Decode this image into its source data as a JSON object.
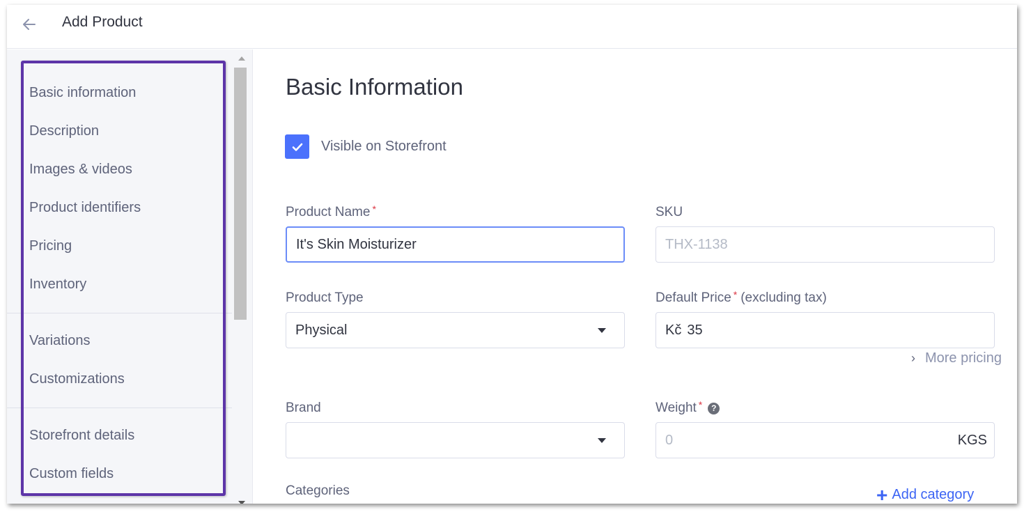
{
  "header": {
    "back_icon": "arrow-left-icon",
    "title": "Add Product"
  },
  "sidebar": {
    "groups": [
      {
        "items": [
          {
            "label": "Basic information"
          },
          {
            "label": "Description"
          },
          {
            "label": "Images & videos"
          },
          {
            "label": "Product identifiers"
          },
          {
            "label": "Pricing"
          },
          {
            "label": "Inventory"
          }
        ]
      },
      {
        "items": [
          {
            "label": "Variations"
          },
          {
            "label": "Customizations"
          }
        ]
      },
      {
        "items": [
          {
            "label": "Storefront details"
          },
          {
            "label": "Custom fields"
          }
        ]
      }
    ],
    "highlight_color": "#5d35a8"
  },
  "main": {
    "section_title": "Basic Information",
    "visible_on_storefront": {
      "label": "Visible on Storefront",
      "checked": true
    },
    "fields": {
      "product_name": {
        "label": "Product Name",
        "required_mark": "*",
        "value": "It's Skin Moisturizer"
      },
      "sku": {
        "label": "SKU",
        "placeholder": "THX-1138",
        "value": ""
      },
      "product_type": {
        "label": "Product Type",
        "value": "Physical"
      },
      "default_price": {
        "label": "Default Price",
        "required_mark": "*",
        "label_suffix": "(excluding tax)",
        "currency_prefix": "Kč",
        "value": "35"
      },
      "brand": {
        "label": "Brand",
        "value": ""
      },
      "weight": {
        "label": "Weight",
        "required_mark": "*",
        "help_icon": "?",
        "placeholder": "0",
        "unit": "KGS"
      }
    },
    "more_pricing": {
      "chevron": "›",
      "label": "More pricing"
    },
    "categories": {
      "label": "Categories",
      "add_label": "Add category",
      "add_icon": "+"
    }
  },
  "colors": {
    "accent": "#4b71fc",
    "link": "#3c64f4",
    "required": "#db3643",
    "highlight_border": "#5d35a8"
  }
}
